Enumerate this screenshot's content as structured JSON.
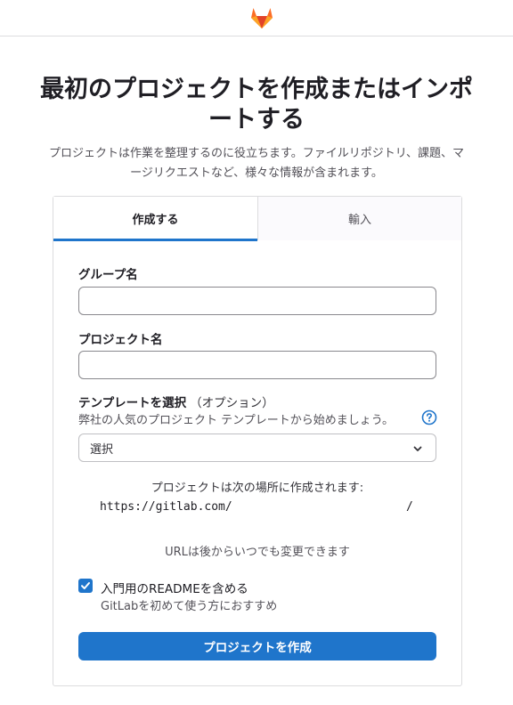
{
  "header": {
    "logo_icon": "gitlab-tanuki-icon"
  },
  "page": {
    "title": "最初のプロジェクトを作成またはインポートする",
    "subtitle": "プロジェクトは作業を整理するのに役立ちます。ファイルリポジトリ、課題、マージリクエストなど、様々な情報が含まれます。"
  },
  "tabs": [
    {
      "label": "作成する",
      "active": true
    },
    {
      "label": "輸入",
      "active": false
    }
  ],
  "form": {
    "group_name": {
      "label": "グループ名",
      "value": "",
      "placeholder": ""
    },
    "project_name": {
      "label": "プロジェクト名",
      "value": "",
      "placeholder": ""
    },
    "template": {
      "label": "テンプレートを選択",
      "optional": "（オプション）",
      "help": "弊社の人気のプロジェクト テンプレートから始めましょう。",
      "help_icon": "question-circle-icon",
      "selected": "選択",
      "chevron_icon": "chevron-down-icon"
    },
    "url": {
      "caption": "プロジェクトは次の場所に作成されます:",
      "base": "https://gitlab.com/",
      "separator": "/",
      "note": "URLは後からいつでも変更できます"
    },
    "readme": {
      "checked": true,
      "label": "入門用のREADMEを含める",
      "help": "GitLabを初めて使う方におすすめ"
    },
    "submit_label": "プロジェクトを作成"
  },
  "colors": {
    "accent": "#1f75cb",
    "logo_orange": "#e24329"
  }
}
